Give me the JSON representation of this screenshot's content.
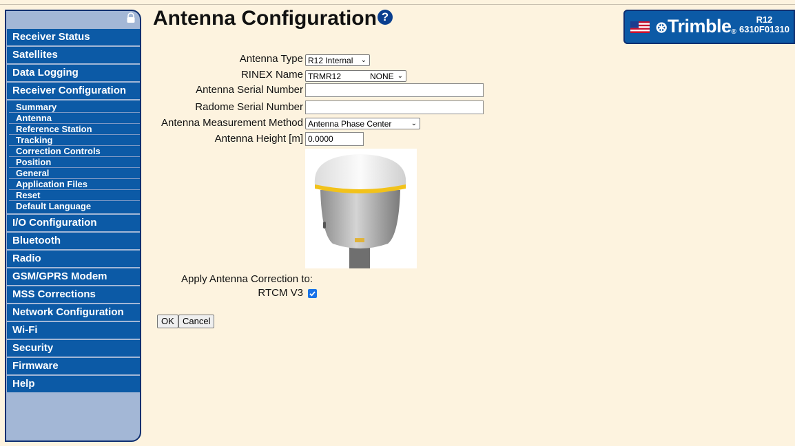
{
  "page": {
    "title": "Antenna Configuration",
    "help_icon": "question-circle-icon"
  },
  "brand": {
    "flag": "us-flag",
    "logo": "Trimble",
    "reg": "®",
    "model": "R12",
    "serial": "6310F01310"
  },
  "sidebar": {
    "items_top": [
      {
        "label": "Receiver Status"
      },
      {
        "label": "Satellites"
      },
      {
        "label": "Data Logging"
      },
      {
        "label": "Receiver Configuration"
      }
    ],
    "sub_items": [
      {
        "label": "Summary"
      },
      {
        "label": "Antenna"
      },
      {
        "label": "Reference Station"
      },
      {
        "label": "Tracking"
      },
      {
        "label": "Correction Controls"
      },
      {
        "label": "Position"
      },
      {
        "label": "General"
      },
      {
        "label": "Application Files"
      },
      {
        "label": "Reset"
      },
      {
        "label": "Default Language"
      }
    ],
    "items_bottom": [
      {
        "label": "I/O Configuration"
      },
      {
        "label": "Bluetooth"
      },
      {
        "label": "Radio"
      },
      {
        "label": "GSM/GPRS Modem"
      },
      {
        "label": "MSS Corrections"
      },
      {
        "label": "Network Configuration"
      },
      {
        "label": "Wi-Fi"
      },
      {
        "label": "Security"
      },
      {
        "label": "Firmware"
      },
      {
        "label": "Help"
      }
    ]
  },
  "form": {
    "antenna_type": {
      "label": "Antenna Type",
      "value": "R12 Internal"
    },
    "rinex_name": {
      "label": "RINEX Name",
      "value": "TRMR12",
      "radome": "NONE"
    },
    "antenna_serial": {
      "label": "Antenna Serial Number",
      "value": ""
    },
    "radome_serial": {
      "label": "Radome Serial Number",
      "value": ""
    },
    "measurement_method": {
      "label": "Antenna Measurement Method",
      "value": "Antenna Phase Center"
    },
    "antenna_height": {
      "label": "Antenna Height [m]",
      "value": "0.0000"
    },
    "apply_correction_label": "Apply Antenna Correction to:",
    "rtcm_v3": {
      "label": "RTCM V3",
      "checked": true
    },
    "ok_label": "OK",
    "cancel_label": "Cancel"
  },
  "colors": {
    "nav_bg": "#0c5aa6",
    "sidebar_bg": "#a3b7d6",
    "page_bg": "#fdf3df"
  }
}
